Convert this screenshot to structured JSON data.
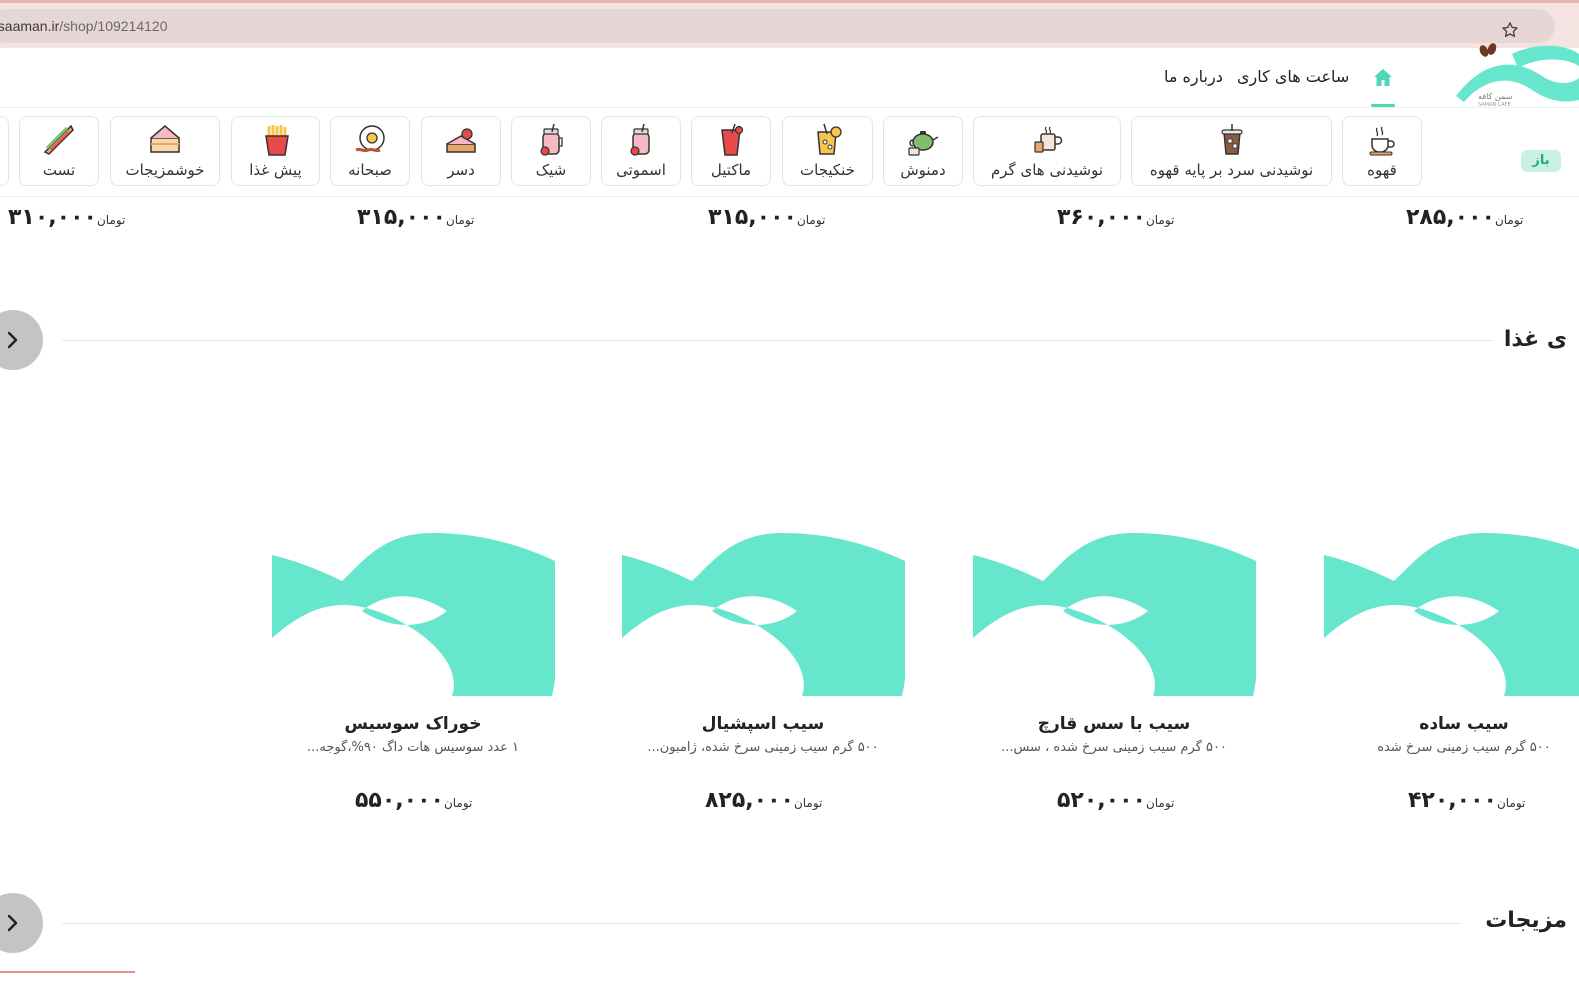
{
  "browser": {
    "url_domain": "esaaman.ir",
    "url_path": "/shop/109214120"
  },
  "header": {
    "nav": [
      {
        "label": "ساعت های کاری"
      },
      {
        "label": "درباره ما"
      }
    ],
    "logo_text": "سمن کافه",
    "logo_subtext": "SAMAN CAFE",
    "status_badge": "باز"
  },
  "categories": [
    {
      "label": "قهوه",
      "icon": "coffee-cup-icon"
    },
    {
      "label": "نوشیدنی سرد بر پایه قهوه",
      "icon": "iced-coffee-icon"
    },
    {
      "label": "نوشیدنی های گرم",
      "icon": "hot-drinks-icon"
    },
    {
      "label": "دمنوش",
      "icon": "teapot-icon"
    },
    {
      "label": "خنکیجات",
      "icon": "lemonade-icon"
    },
    {
      "label": "ماکتیل",
      "icon": "mocktail-icon"
    },
    {
      "label": "اسموتی",
      "icon": "smoothie-jar-icon"
    },
    {
      "label": "شیک",
      "icon": "milkshake-jar-icon"
    },
    {
      "label": "دسر",
      "icon": "cake-icon"
    },
    {
      "label": "صبحانه",
      "icon": "fried-egg-icon"
    },
    {
      "label": "پیش غذا",
      "icon": "french-fries-icon"
    },
    {
      "label": "خوشمزیجات",
      "icon": "snack-cake-icon"
    },
    {
      "label": "تست",
      "icon": "sandwich-icon"
    }
  ],
  "top_prices": [
    {
      "value": "۲۸۵,۰۰۰",
      "currency": "تومان"
    },
    {
      "value": "۳۶۰,۰۰۰",
      "currency": "تومان"
    },
    {
      "value": "۳۱۵,۰۰۰",
      "currency": "تومان"
    },
    {
      "value": "۳۱۵,۰۰۰",
      "currency": "تومان"
    },
    {
      "value": "۳۱۰,۰۰۰",
      "currency": "تومان"
    }
  ],
  "section_appetizer": {
    "title": "ی غذا",
    "products": [
      {
        "name": "سیب ساده",
        "desc": "۵۰۰ گرم سیب زمینی سرخ شده",
        "price": "۴۲۰,۰۰۰",
        "currency": "تومان"
      },
      {
        "name": "سیب با سس قارچ",
        "desc": "۵۰۰ گرم سیب زمینی سرخ شده ، سس...",
        "price": "۵۲۰,۰۰۰",
        "currency": "تومان"
      },
      {
        "name": "سیب اسپشیال",
        "desc": "۵۰۰ گرم سیب زمینی سرخ شده، ژامبون...",
        "price": "۸۲۵,۰۰۰",
        "currency": "تومان"
      },
      {
        "name": "خوراک سوسیس",
        "desc": "۱ عدد سوسیس هات داگ ۹۰%،گوجه...",
        "price": "۵۵۰,۰۰۰",
        "currency": "تومان"
      }
    ]
  },
  "section_snacks": {
    "title": "مزیجات"
  },
  "colors": {
    "brand": "#66e6cd",
    "accent": "#4fd6b4",
    "badge_bg": "#c9f0e4"
  }
}
